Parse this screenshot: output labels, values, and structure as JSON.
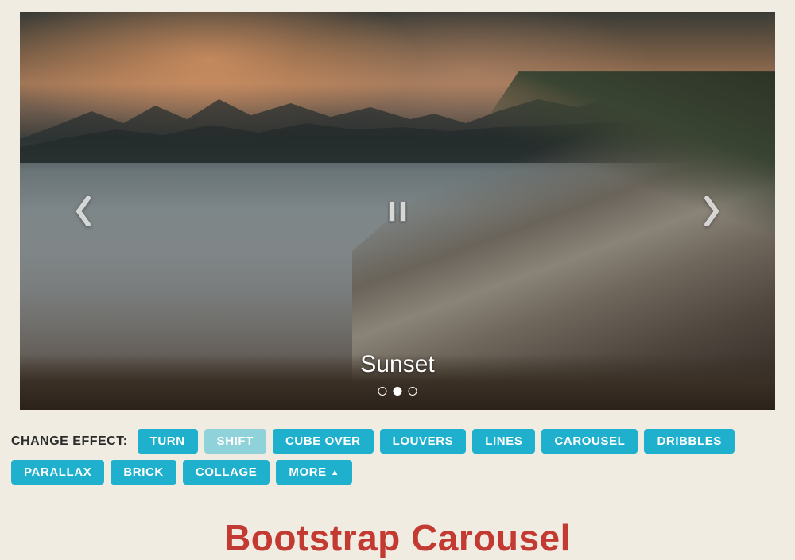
{
  "carousel": {
    "caption": "Sunset",
    "slide_count": 3,
    "active_index": 1
  },
  "effects": {
    "label": "CHANGE EFFECT:",
    "active_index": 1,
    "items": [
      "TURN",
      "SHIFT",
      "CUBE OVER",
      "LOUVERS",
      "LINES",
      "CAROUSEL",
      "DRIBBLES",
      "PARALLAX",
      "BRICK",
      "COLLAGE"
    ],
    "more_label": "MORE"
  },
  "heading": "Bootstrap Carousel"
}
